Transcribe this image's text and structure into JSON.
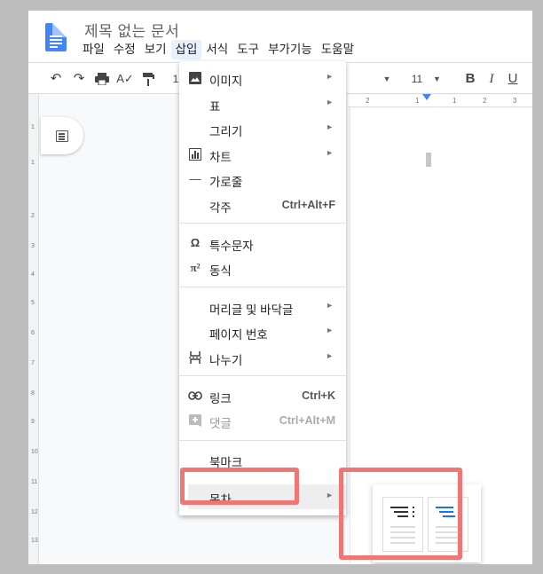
{
  "doc": {
    "title": "제목 없는 문서"
  },
  "menubar": [
    "파일",
    "수정",
    "보기",
    "삽입",
    "서식",
    "도구",
    "부가기능",
    "도움말"
  ],
  "toolbar": {
    "zoom_fragment": "1",
    "font_size": "11",
    "bold": "B",
    "italic": "I",
    "underline": "U"
  },
  "ruler": {
    "h_ticks": [
      "2",
      "1",
      "1",
      "2",
      "3"
    ],
    "v_ticks": [
      "1",
      "1",
      "2",
      "3",
      "4",
      "5",
      "6",
      "7",
      "8",
      "9",
      "10",
      "11",
      "12",
      "13"
    ]
  },
  "insert_menu": {
    "items": [
      {
        "label": "이미지",
        "icon": "image-icon",
        "submenu": true
      },
      {
        "label": "표",
        "submenu": true
      },
      {
        "label": "그리기",
        "submenu": true
      },
      {
        "label": "차트",
        "icon": "chart-icon",
        "submenu": true
      },
      {
        "label": "가로줄",
        "icon": "horizontal-line-icon"
      },
      {
        "label": "각주",
        "shortcut": "Ctrl+Alt+F"
      },
      {
        "label": "특수문자",
        "icon": "omega-icon"
      },
      {
        "label": "동식",
        "icon": "pi-icon"
      },
      {
        "label": "머리글 및 바닥글",
        "submenu": true
      },
      {
        "label": "페이지 번호",
        "submenu": true
      },
      {
        "label": "나누기",
        "icon": "page-break-icon",
        "submenu": true
      },
      {
        "label": "링크",
        "icon": "link-icon",
        "shortcut": "Ctrl+K"
      },
      {
        "label": "댓글",
        "icon": "comment-add-icon",
        "shortcut": "Ctrl+Alt+M",
        "disabled": true
      },
      {
        "label": "북마크"
      },
      {
        "label": "목차",
        "submenu": true,
        "highlighted": true
      }
    ]
  },
  "toc_submenu": {
    "options": [
      "toc-with-page-numbers",
      "toc-with-blue-links"
    ]
  },
  "colors": {
    "highlight": "#f07575",
    "accent": "#4285f4",
    "link_blue": "#1a73e8"
  }
}
